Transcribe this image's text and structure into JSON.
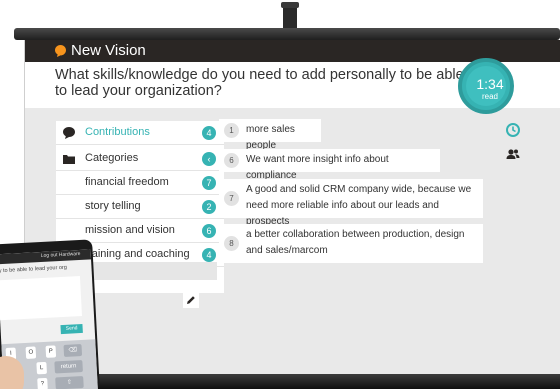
{
  "app": {
    "title": "New Vision"
  },
  "question": {
    "text": "What skills/knowledge do you need to add personally to be able to lead your organization?"
  },
  "timer": {
    "time": "1:34",
    "label": "read"
  },
  "sidebar": {
    "contributions": {
      "label": "Contributions",
      "count": "4",
      "icon": "speech-bubble-icon"
    },
    "categories": {
      "label": "Categories",
      "icon": "folder-icon",
      "toggle_icon": "chevron-left-icon"
    },
    "items": [
      {
        "label": "financial freedom",
        "count": "7"
      },
      {
        "label": "story telling",
        "count": "2"
      },
      {
        "label": "mission and vision",
        "count": "6"
      },
      {
        "label": "training and coaching",
        "count": "4"
      }
    ],
    "category_placeholder": "gory"
  },
  "cards": [
    {
      "num": "1",
      "text": "more sales people"
    },
    {
      "num": "6",
      "text": "We want more insight info about compliance"
    },
    {
      "num": "7",
      "text": "A good and solid CRM company wide, because we need more reliable info about our leads and prospects"
    },
    {
      "num": "8",
      "text": "a better collaboration between production, design and sales/marcom"
    }
  ],
  "right_icons": [
    "clock-icon",
    "people-icon"
  ],
  "tablet": {
    "bar_text": "Log out Hardware",
    "question_fragment": "ly to be able to lead your org",
    "send_label": "Send",
    "keys": [
      "I",
      "O",
      "P",
      "L",
      "return",
      "?"
    ]
  },
  "colors": {
    "accent": "#36b3b3",
    "header": "#2a2624",
    "logo": "#f7941d"
  }
}
